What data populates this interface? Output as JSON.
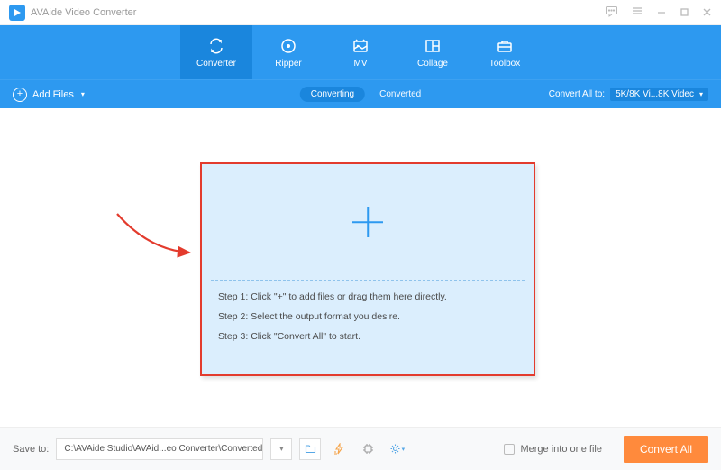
{
  "app": {
    "title": "AVAide Video Converter"
  },
  "nav": {
    "items": [
      {
        "label": "Converter"
      },
      {
        "label": "Ripper"
      },
      {
        "label": "MV"
      },
      {
        "label": "Collage"
      },
      {
        "label": "Toolbox"
      }
    ]
  },
  "subbar": {
    "add_files": "Add Files",
    "tab_converting": "Converting",
    "tab_converted": "Converted",
    "convert_all_to": "Convert All to:",
    "format_value": "5K/8K Vi...8K Videc"
  },
  "dropzone": {
    "step1": "Step 1: Click \"+\" to add files or drag them here directly.",
    "step2": "Step 2: Select the output format you desire.",
    "step3": "Step 3: Click \"Convert All\" to start."
  },
  "bottom": {
    "save_to": "Save to:",
    "path": "C:\\AVAide Studio\\AVAid...eo Converter\\Converted",
    "merge": "Merge into one file",
    "convert_all": "Convert All"
  }
}
